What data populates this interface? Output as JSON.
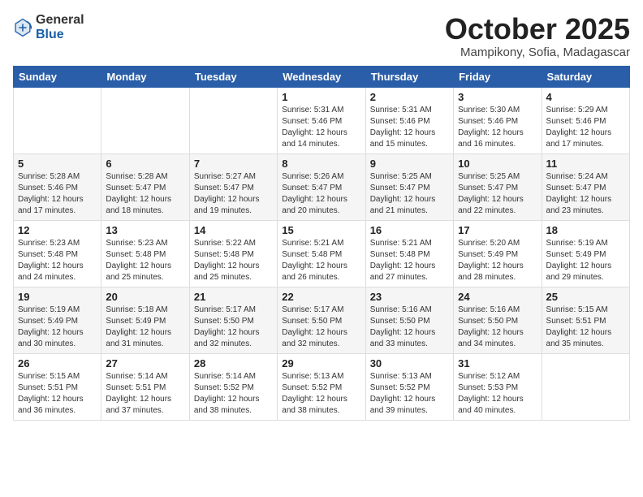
{
  "header": {
    "logo_general": "General",
    "logo_blue": "Blue",
    "month_title": "October 2025",
    "subtitle": "Mampikony, Sofia, Madagascar"
  },
  "weekdays": [
    "Sunday",
    "Monday",
    "Tuesday",
    "Wednesday",
    "Thursday",
    "Friday",
    "Saturday"
  ],
  "weeks": [
    [
      {
        "day": "",
        "info": ""
      },
      {
        "day": "",
        "info": ""
      },
      {
        "day": "",
        "info": ""
      },
      {
        "day": "1",
        "info": "Sunrise: 5:31 AM\nSunset: 5:46 PM\nDaylight: 12 hours\nand 14 minutes."
      },
      {
        "day": "2",
        "info": "Sunrise: 5:31 AM\nSunset: 5:46 PM\nDaylight: 12 hours\nand 15 minutes."
      },
      {
        "day": "3",
        "info": "Sunrise: 5:30 AM\nSunset: 5:46 PM\nDaylight: 12 hours\nand 16 minutes."
      },
      {
        "day": "4",
        "info": "Sunrise: 5:29 AM\nSunset: 5:46 PM\nDaylight: 12 hours\nand 17 minutes."
      }
    ],
    [
      {
        "day": "5",
        "info": "Sunrise: 5:28 AM\nSunset: 5:46 PM\nDaylight: 12 hours\nand 17 minutes."
      },
      {
        "day": "6",
        "info": "Sunrise: 5:28 AM\nSunset: 5:47 PM\nDaylight: 12 hours\nand 18 minutes."
      },
      {
        "day": "7",
        "info": "Sunrise: 5:27 AM\nSunset: 5:47 PM\nDaylight: 12 hours\nand 19 minutes."
      },
      {
        "day": "8",
        "info": "Sunrise: 5:26 AM\nSunset: 5:47 PM\nDaylight: 12 hours\nand 20 minutes."
      },
      {
        "day": "9",
        "info": "Sunrise: 5:25 AM\nSunset: 5:47 PM\nDaylight: 12 hours\nand 21 minutes."
      },
      {
        "day": "10",
        "info": "Sunrise: 5:25 AM\nSunset: 5:47 PM\nDaylight: 12 hours\nand 22 minutes."
      },
      {
        "day": "11",
        "info": "Sunrise: 5:24 AM\nSunset: 5:47 PM\nDaylight: 12 hours\nand 23 minutes."
      }
    ],
    [
      {
        "day": "12",
        "info": "Sunrise: 5:23 AM\nSunset: 5:48 PM\nDaylight: 12 hours\nand 24 minutes."
      },
      {
        "day": "13",
        "info": "Sunrise: 5:23 AM\nSunset: 5:48 PM\nDaylight: 12 hours\nand 25 minutes."
      },
      {
        "day": "14",
        "info": "Sunrise: 5:22 AM\nSunset: 5:48 PM\nDaylight: 12 hours\nand 25 minutes."
      },
      {
        "day": "15",
        "info": "Sunrise: 5:21 AM\nSunset: 5:48 PM\nDaylight: 12 hours\nand 26 minutes."
      },
      {
        "day": "16",
        "info": "Sunrise: 5:21 AM\nSunset: 5:48 PM\nDaylight: 12 hours\nand 27 minutes."
      },
      {
        "day": "17",
        "info": "Sunrise: 5:20 AM\nSunset: 5:49 PM\nDaylight: 12 hours\nand 28 minutes."
      },
      {
        "day": "18",
        "info": "Sunrise: 5:19 AM\nSunset: 5:49 PM\nDaylight: 12 hours\nand 29 minutes."
      }
    ],
    [
      {
        "day": "19",
        "info": "Sunrise: 5:19 AM\nSunset: 5:49 PM\nDaylight: 12 hours\nand 30 minutes."
      },
      {
        "day": "20",
        "info": "Sunrise: 5:18 AM\nSunset: 5:49 PM\nDaylight: 12 hours\nand 31 minutes."
      },
      {
        "day": "21",
        "info": "Sunrise: 5:17 AM\nSunset: 5:50 PM\nDaylight: 12 hours\nand 32 minutes."
      },
      {
        "day": "22",
        "info": "Sunrise: 5:17 AM\nSunset: 5:50 PM\nDaylight: 12 hours\nand 32 minutes."
      },
      {
        "day": "23",
        "info": "Sunrise: 5:16 AM\nSunset: 5:50 PM\nDaylight: 12 hours\nand 33 minutes."
      },
      {
        "day": "24",
        "info": "Sunrise: 5:16 AM\nSunset: 5:50 PM\nDaylight: 12 hours\nand 34 minutes."
      },
      {
        "day": "25",
        "info": "Sunrise: 5:15 AM\nSunset: 5:51 PM\nDaylight: 12 hours\nand 35 minutes."
      }
    ],
    [
      {
        "day": "26",
        "info": "Sunrise: 5:15 AM\nSunset: 5:51 PM\nDaylight: 12 hours\nand 36 minutes."
      },
      {
        "day": "27",
        "info": "Sunrise: 5:14 AM\nSunset: 5:51 PM\nDaylight: 12 hours\nand 37 minutes."
      },
      {
        "day": "28",
        "info": "Sunrise: 5:14 AM\nSunset: 5:52 PM\nDaylight: 12 hours\nand 38 minutes."
      },
      {
        "day": "29",
        "info": "Sunrise: 5:13 AM\nSunset: 5:52 PM\nDaylight: 12 hours\nand 38 minutes."
      },
      {
        "day": "30",
        "info": "Sunrise: 5:13 AM\nSunset: 5:52 PM\nDaylight: 12 hours\nand 39 minutes."
      },
      {
        "day": "31",
        "info": "Sunrise: 5:12 AM\nSunset: 5:53 PM\nDaylight: 12 hours\nand 40 minutes."
      },
      {
        "day": "",
        "info": ""
      }
    ]
  ]
}
